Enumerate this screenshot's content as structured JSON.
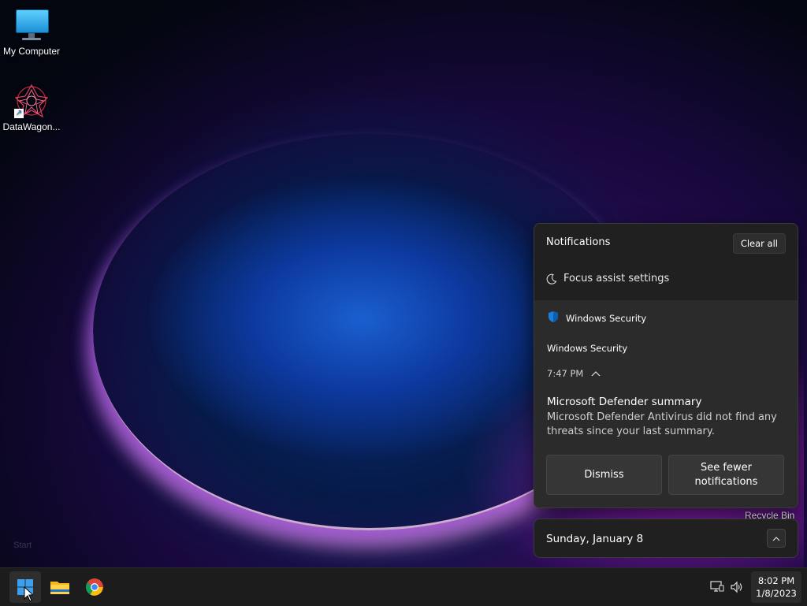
{
  "desktop": {
    "icons": [
      {
        "label": "My Computer",
        "icon": "monitor-icon"
      },
      {
        "label": "DataWagon...",
        "icon": "datawagon-icon"
      }
    ],
    "start_ghost_text": "Start",
    "recycle_bin_label": "Recycle Bin"
  },
  "notifications": {
    "title": "Notifications",
    "clear_all_label": "Clear all",
    "focus_assist_label": "Focus assist settings",
    "card": {
      "app_name": "Windows Security",
      "app_name_secondary": "Windows Security",
      "time": "7:47 PM",
      "title": "Microsoft Defender summary",
      "body": "Microsoft Defender Antivirus did not find any threats since your last summary.",
      "dismiss_label": "Dismiss",
      "see_fewer_label": "See fewer notifications"
    }
  },
  "calendar": {
    "date_label": "Sunday, January 8"
  },
  "taskbar": {
    "apps": [
      "start-icon",
      "file-explorer-icon",
      "chrome-icon"
    ],
    "tray": [
      "network-icon",
      "volume-icon"
    ],
    "clock_time": "8:02 PM",
    "clock_date": "1/8/2023"
  },
  "colors": {
    "panel_bg": "#202020",
    "card_bg": "#2b2b2b",
    "taskbar_bg": "#1c1c1c",
    "accent": "#1a6fd0"
  }
}
